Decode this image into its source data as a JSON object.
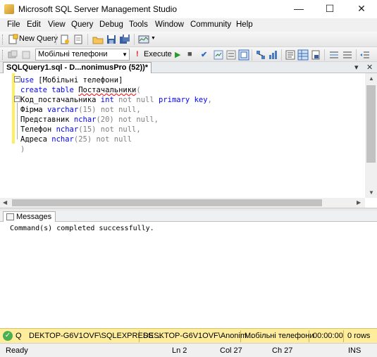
{
  "window": {
    "title": "Microsoft SQL Server Management Studio",
    "controls": {
      "minimize": "—",
      "maximize": "☐",
      "close": "✕"
    }
  },
  "menu": [
    "File",
    "Edit",
    "View",
    "Query",
    "Debug",
    "Tools",
    "Window",
    "Community",
    "Help"
  ],
  "toolbar1": {
    "new_query_label": "New Query"
  },
  "toolbar2": {
    "database": "Мобільні телефони",
    "execute_label": "Execute"
  },
  "document_tab": {
    "label": "SQLQuery1.sql - D...nonimusPro (52))*"
  },
  "editor": {
    "lines": [
      {
        "parts": [
          {
            "t": "use",
            "c": "kw"
          },
          {
            "t": " [Мобільні телефони]",
            "c": ""
          }
        ]
      },
      {
        "parts": [
          {
            "t": "create",
            "c": "kw"
          },
          {
            "t": " ",
            "c": ""
          },
          {
            "t": "table",
            "c": "kw"
          },
          {
            "t": " ",
            "c": ""
          },
          {
            "t": "Постачальники",
            "c": "squig"
          },
          {
            "t": "(",
            "c": "gr"
          }
        ]
      },
      {
        "parts": [
          {
            "t": "Код_постачальника ",
            "c": ""
          },
          {
            "t": "int",
            "c": "kw"
          },
          {
            "t": " ",
            "c": ""
          },
          {
            "t": "not null",
            "c": "gr"
          },
          {
            "t": " ",
            "c": ""
          },
          {
            "t": "primary key",
            "c": "kw"
          },
          {
            "t": ",",
            "c": "gr"
          }
        ]
      },
      {
        "parts": [
          {
            "t": "Фірма ",
            "c": ""
          },
          {
            "t": "varchar",
            "c": "kw"
          },
          {
            "t": "(15) ",
            "c": "gr"
          },
          {
            "t": "not null",
            "c": "gr"
          },
          {
            "t": ",",
            "c": "gr"
          }
        ]
      },
      {
        "parts": [
          {
            "t": "Представник ",
            "c": ""
          },
          {
            "t": "nchar",
            "c": "kw"
          },
          {
            "t": "(20) ",
            "c": "gr"
          },
          {
            "t": "not null",
            "c": "gr"
          },
          {
            "t": ",",
            "c": "gr"
          }
        ]
      },
      {
        "parts": [
          {
            "t": "Телефон ",
            "c": ""
          },
          {
            "t": "nchar",
            "c": "kw"
          },
          {
            "t": "(15) ",
            "c": "gr"
          },
          {
            "t": "not null",
            "c": "gr"
          },
          {
            "t": ",",
            "c": "gr"
          }
        ]
      },
      {
        "parts": [
          {
            "t": "Адреса ",
            "c": ""
          },
          {
            "t": "nchar",
            "c": "kw"
          },
          {
            "t": "(25) ",
            "c": "gr"
          },
          {
            "t": "not null",
            "c": "gr"
          }
        ]
      },
      {
        "parts": [
          {
            "t": ")",
            "c": "gr"
          }
        ]
      }
    ]
  },
  "messages": {
    "tab_label": "Messages",
    "text": "Command(s) completed successfully."
  },
  "connection_bar": {
    "status_prefix": "Q",
    "server": "DEKTOP-G6V1OVF\\SQLEXPRESS ...",
    "user": "DESKTOP-G6V1OVF\\Anonim...",
    "database": "Мобільні телефони",
    "elapsed": "00:00:00",
    "rows": "0 rows"
  },
  "statusbar": {
    "ready": "Ready",
    "line": "Ln 2",
    "col": "Col 27",
    "ch": "Ch 27",
    "mode": "INS"
  },
  "colors": {
    "keyword": "#0000ff",
    "gray": "#808080",
    "connection_bar": "#ffed9e"
  }
}
